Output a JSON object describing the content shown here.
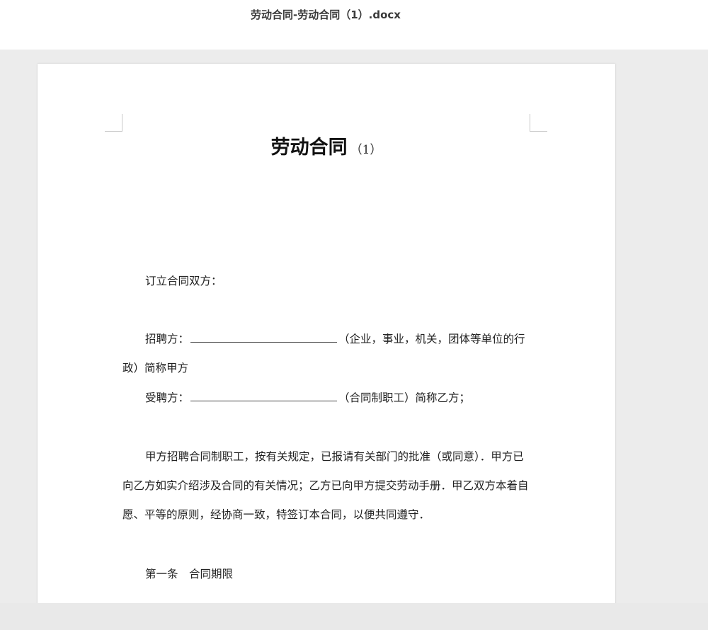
{
  "window": {
    "title": "劳动合同-劳动合同（1）.docx"
  },
  "document": {
    "heading": "劳动合同",
    "heading_suffix": "（1）",
    "parties_intro": "订立合同双方：",
    "employer_label": "招聘方：",
    "employer_note_line1": "（企业，事业，机关，团体等单位的行",
    "employer_note_line2": "政）简称甲方",
    "employee_label": "受聘方：",
    "employee_note": "（合同制职工）简称乙方；",
    "body_paragraph": "甲方招聘合同制职工，按有关规定，已报请有关部门的批准（或同意）．甲方已向乙方如实介绍涉及合同的有关情况；乙方已向甲方提交劳动手册．甲乙双方本着自愿、平等的原则，经协商一致，特签订本合同，以便共同遵守．",
    "article_1": "第一条　合同期限"
  }
}
